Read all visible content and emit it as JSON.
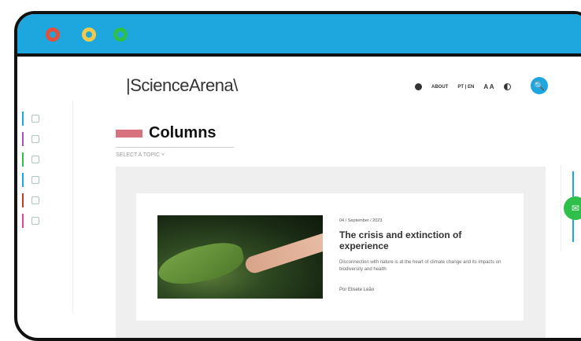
{
  "window": {
    "controls": [
      "close",
      "minimize",
      "maximize"
    ]
  },
  "brand": {
    "logo": "|ScienceArena\\"
  },
  "nav": {
    "about": "ABOUT",
    "lang": "PT | EN",
    "text_size": "A A"
  },
  "page": {
    "title": "Columns",
    "topic_select": "SELECT A TOPIC"
  },
  "article": {
    "date": "04 / September / 2023",
    "title": "The crisis and extinction of experience",
    "description": "Disconnection with nature is at the heart of climate change and its impacts on biodiversity and health",
    "author": "Por Elisete Leão"
  },
  "sidebar": {
    "items": [
      {
        "color": "#1ea7df"
      },
      {
        "color": "#9b59b6"
      },
      {
        "color": "#2fbf4b"
      },
      {
        "color": "#1ea7df"
      },
      {
        "color": "#c0392b"
      },
      {
        "color": "#e84393"
      }
    ]
  },
  "colors": {
    "accent": "#1ea7df",
    "green": "#2fbf4b",
    "title_accent": "#d9727f"
  }
}
